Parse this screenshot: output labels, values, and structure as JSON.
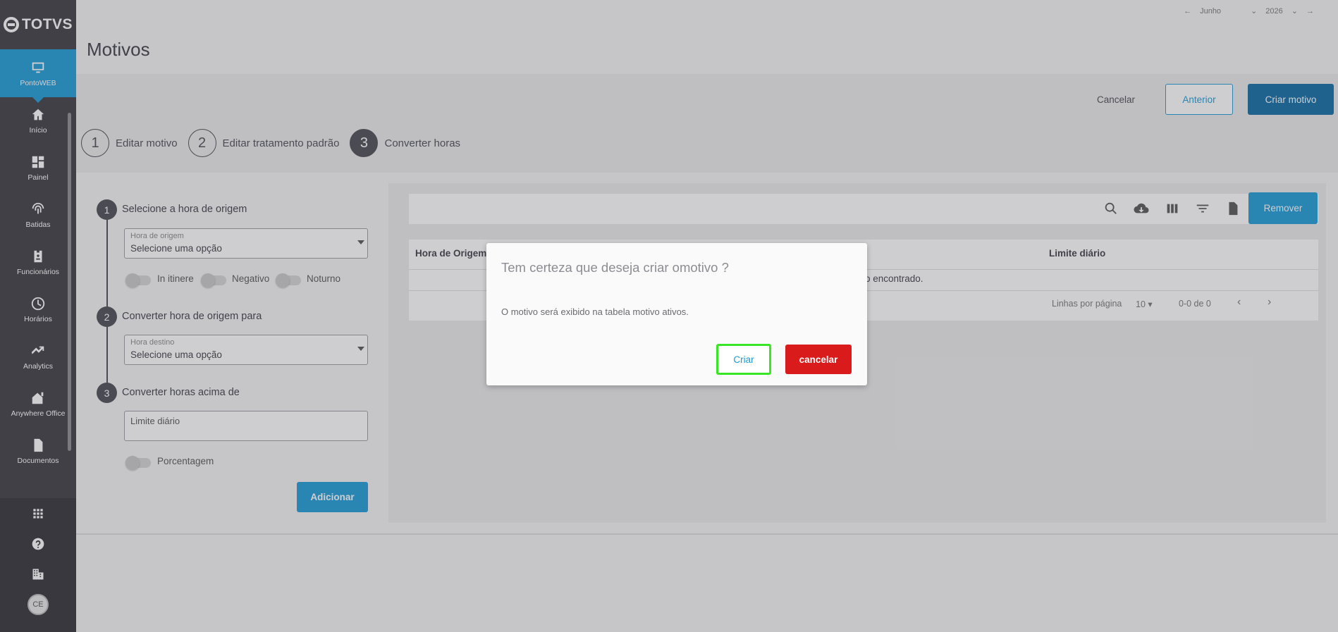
{
  "brand": {
    "logo_text": "TOTVS"
  },
  "sidebar": {
    "items": [
      {
        "label": "PontoWEB",
        "icon": "monitor-icon",
        "active": true
      },
      {
        "label": "Início",
        "icon": "home-icon"
      },
      {
        "label": "Painel",
        "icon": "dashboard-icon"
      },
      {
        "label": "Batidas",
        "icon": "fingerprint-icon"
      },
      {
        "label": "Funcionários",
        "icon": "badge-icon"
      },
      {
        "label": "Horários",
        "icon": "clock-icon"
      },
      {
        "label": "Analytics",
        "icon": "trending-up-icon"
      },
      {
        "label": "Anywhere Office",
        "icon": "house-work-icon"
      },
      {
        "label": "Documentos",
        "icon": "document-icon"
      }
    ],
    "bottom": {
      "avatar_initials": "CE"
    }
  },
  "date_selector": {
    "month": "Junho",
    "year": "2026"
  },
  "page": {
    "title": "Motivos"
  },
  "actions": {
    "cancel": "Cancelar",
    "previous": "Anterior",
    "create": "Criar motivo"
  },
  "stepper": [
    {
      "num": "1",
      "label": "Editar motivo"
    },
    {
      "num": "2",
      "label": "Editar tratamento padrão"
    },
    {
      "num": "3",
      "label": "Converter horas"
    }
  ],
  "form": {
    "step1": {
      "num": "1",
      "label": "Selecione a hora de origem",
      "field_label": "Hora de origem",
      "field_value": "Selecione uma opção"
    },
    "toggles1": [
      "In itinere",
      "Negativo",
      "Noturno"
    ],
    "step2": {
      "num": "2",
      "label": "Converter hora de origem para",
      "field_label": "Hora destino",
      "field_value": "Selecione uma opção"
    },
    "step3": {
      "num": "3",
      "label": "Converter horas acima de",
      "field_placeholder": "Limite diário"
    },
    "toggle_pct": "Porcentagem",
    "add_button": "Adicionar"
  },
  "table": {
    "remove_button": "Remover",
    "columns": [
      "Hora de Origem",
      "Limite diário"
    ],
    "empty_message": "o encontrado.",
    "rows_per_page_label": "Linhas por página",
    "rows_per_page": "10",
    "range": "0-0 de 0"
  },
  "modal": {
    "title": "Tem certeza que deseja criar omotivo ?",
    "message": "O motivo será exibido na tabela motivo ativos.",
    "confirm": "Criar",
    "cancel": "cancelar"
  }
}
